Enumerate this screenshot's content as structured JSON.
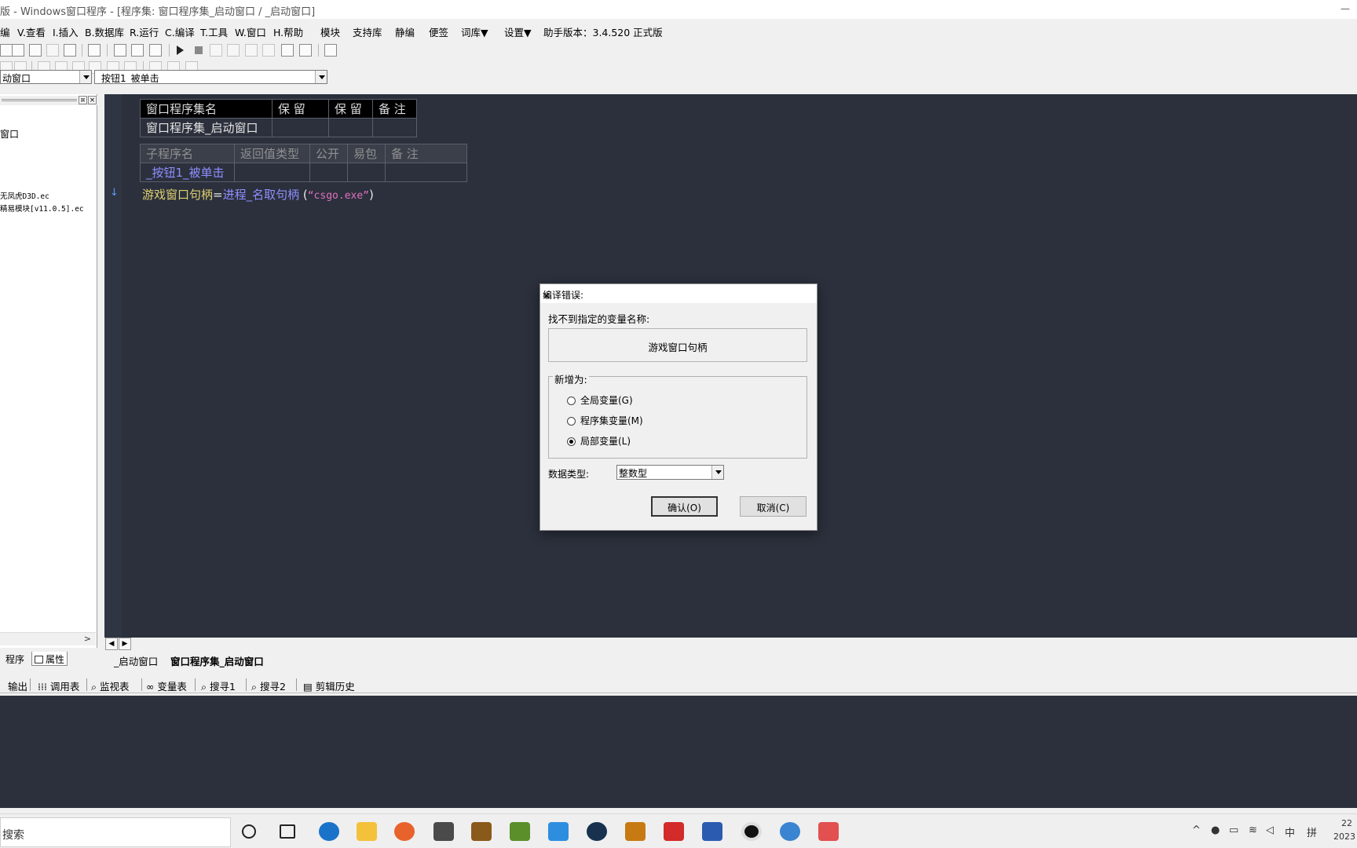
{
  "window": {
    "title": "版 - Windows窗口程序 - [程序集: 窗口程序集_启动窗口 / _启动窗口]",
    "minimize_label": "—"
  },
  "menubar": [
    "编",
    "V.查看",
    "I.插入",
    "B.数据库",
    "R.运行",
    "C.编译",
    "T.工具",
    "W.窗口",
    "H.帮助",
    "模块",
    "支持库",
    "静编",
    "便签",
    "词库▼",
    "设置▼",
    "助手版本：3.4.520 正式版"
  ],
  "combos": {
    "window_select": "动窗口",
    "event_select": "_按钮1_被单击"
  },
  "left_panel": {
    "tree_items": [
      "窗口",
      "无凤虎D3D.ec",
      "精易模块[v11.0.5].ec"
    ],
    "pin_label": "¤",
    "close_label": "×",
    "scroll_right": ">",
    "tabs": [
      "程序",
      "属性"
    ]
  },
  "editor": {
    "grid1": {
      "headers": [
        "窗口程序集名",
        "保 留",
        "保 留",
        "备 注"
      ],
      "row": [
        "窗口程序集_启动窗口",
        "",
        "",
        ""
      ]
    },
    "grid2": {
      "headers": [
        "子程序名",
        "返回值类型",
        "公开",
        "易包",
        "备 注"
      ],
      "row": [
        "_按钮1_被单击",
        "",
        "",
        "",
        ""
      ]
    },
    "code": {
      "var": "游戏窗口句柄",
      "assign": "=",
      "func": "进程_名取句柄",
      "open": " (",
      "arg": "“csgo.exe”",
      "close": ")"
    },
    "arrow": "↓",
    "scroll_left": "◀",
    "scroll_right": "▶",
    "tabs": [
      "_启动窗口",
      "窗口程序集_启动窗口"
    ]
  },
  "output_bar": [
    "输出",
    "调用表",
    "监视表",
    "变量表",
    "搜寻1",
    "搜寻2",
    "剪辑历史"
  ],
  "dialog": {
    "title": "编译错误:",
    "close": "✕",
    "message": "找不到指定的变量名称:",
    "variable": "游戏窗口句柄",
    "group_label": "新增为:",
    "options": [
      {
        "label": "全局变量(G)",
        "selected": false
      },
      {
        "label": "程序集变量(M)",
        "selected": false
      },
      {
        "label": "局部变量(L)",
        "selected": true
      }
    ],
    "datatype_label": "数据类型:",
    "datatype_value": "整数型",
    "ok_label": "确认(O)",
    "cancel_label": "取消(C)"
  },
  "taskbar": {
    "search_placeholder": "搜索",
    "ime_lang": "中",
    "ime_mode": "拼",
    "clock_time": "22",
    "clock_date": "2023"
  }
}
